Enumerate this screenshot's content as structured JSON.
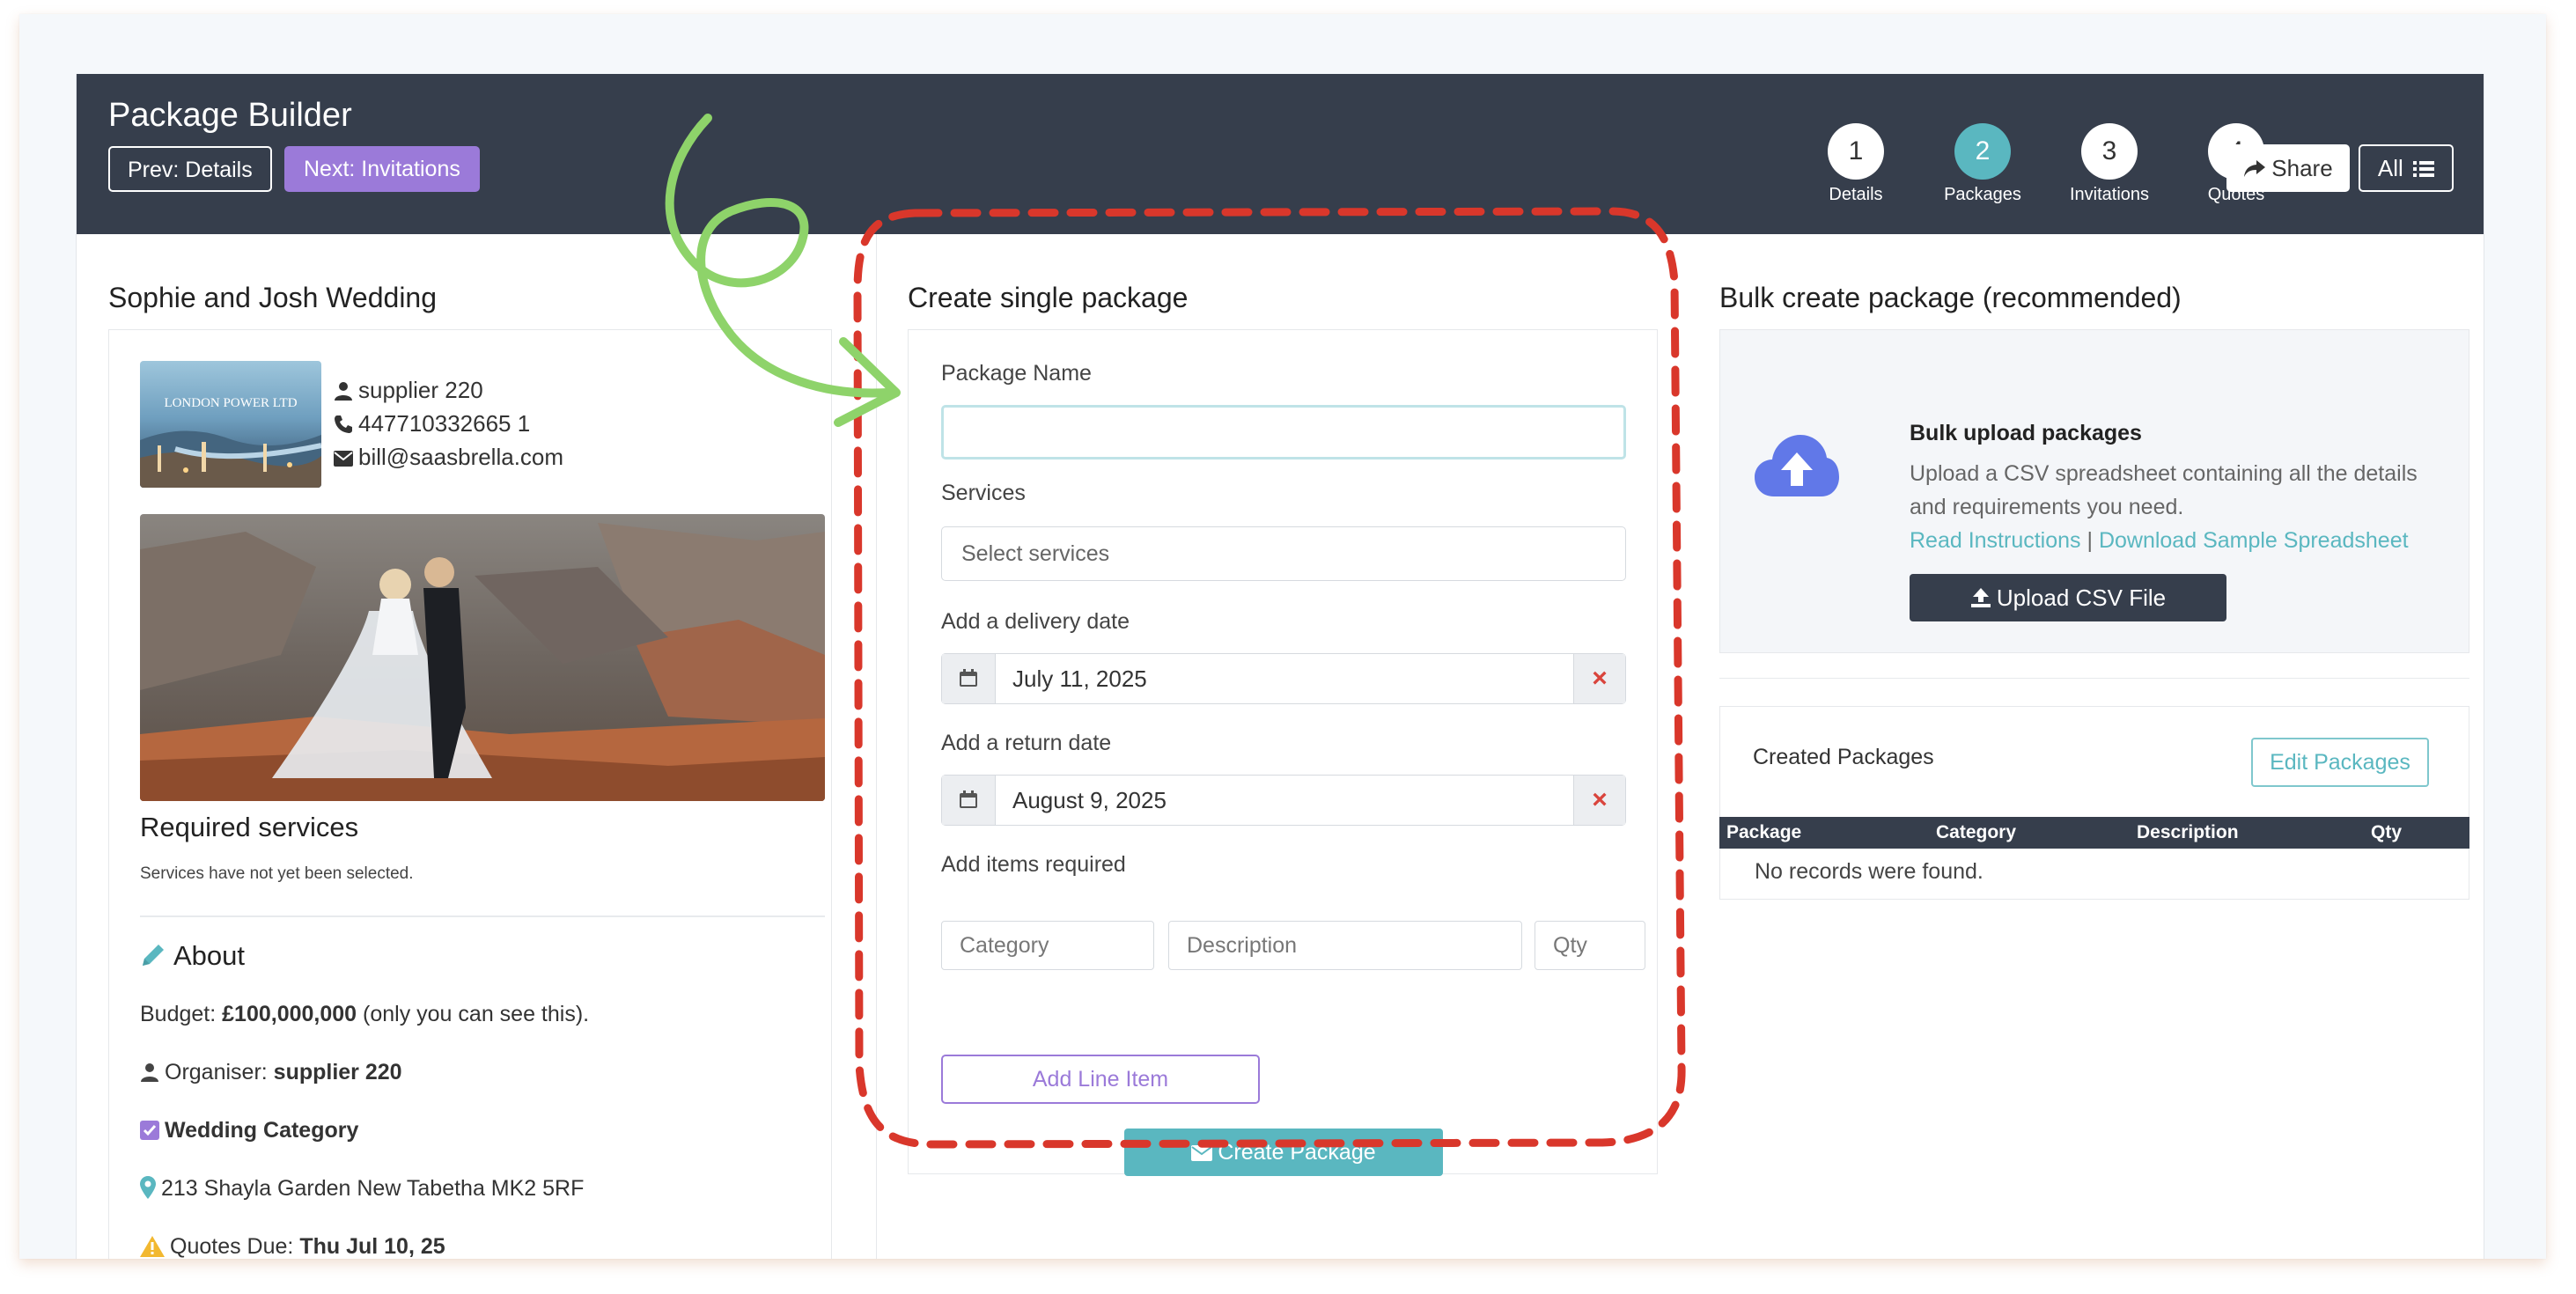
{
  "header": {
    "title": "Package Builder",
    "prev_label": "Prev: Details",
    "next_label": "Next: Invitations",
    "steps": [
      {
        "num": "1",
        "label": "Details"
      },
      {
        "num": "2",
        "label": "Packages"
      },
      {
        "num": "3",
        "label": "Invitations"
      },
      {
        "num": "4",
        "label": "Quotes"
      }
    ],
    "active_step": 2,
    "share_label": "Share",
    "all_label": "All"
  },
  "event": {
    "title": "Sophie and Josh Wedding",
    "logo_text": "LONDON POWER LTD",
    "supplier": "supplier 220",
    "phone": "447710332665 1",
    "email": "bill@saasbrella.com",
    "required_services_title": "Required services",
    "required_services_note": "Services have not yet been selected.",
    "about_title": "About",
    "budget_prefix": "Budget: ",
    "budget_value": "£100,000,000",
    "budget_suffix": " (only you can see this).",
    "organiser_prefix": "Organiser: ",
    "organiser_value": "supplier 220",
    "category": "Wedding Category",
    "address": "213 Shayla Garden New Tabetha MK2 5RF",
    "quotes_prefix": "Quotes Due: ",
    "quotes_value": "Thu Jul 10, 25"
  },
  "form": {
    "title": "Create single package",
    "package_name_label": "Package Name",
    "package_name_value": "",
    "services_label": "Services",
    "services_placeholder": "Select services",
    "delivery_label": "Add a delivery date",
    "delivery_value": "July 11, 2025",
    "return_label": "Add a return date",
    "return_value": "August 9, 2025",
    "items_label": "Add items required",
    "category_placeholder": "Category",
    "description_placeholder": "Description",
    "qty_placeholder": "Qty",
    "add_line_label": "Add Line Item",
    "create_label": "Create Package"
  },
  "bulk": {
    "title": "Bulk create package (recommended)",
    "card_title": "Bulk upload packages",
    "text_line1": "Upload a CSV spreadsheet containing all the details",
    "text_line2": "and requirements you need.",
    "link_instructions": "Read Instructions",
    "link_separator": " | ",
    "link_sample": "Download Sample Spreadsheet",
    "upload_label": "Upload CSV File"
  },
  "created": {
    "title": "Created Packages",
    "edit_label": "Edit Packages",
    "columns": [
      "Package",
      "Category",
      "Description",
      "Qty"
    ],
    "empty_text": "No records were found."
  },
  "colors": {
    "header_bg": "#363e4c",
    "accent_teal": "#5ab7c0",
    "accent_purple": "#9b7ad9",
    "highlight_dash": "#d9372b",
    "arrow_green": "#8ed36a"
  }
}
